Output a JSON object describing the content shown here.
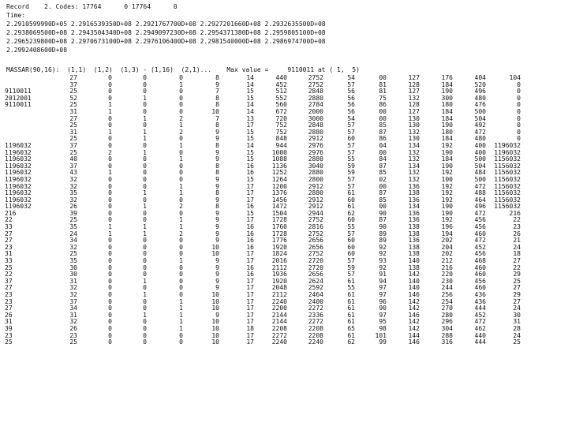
{
  "header": {
    "record_line": "Record    2. Codes: 17764      0 17764      0",
    "times_label": "Time:",
    "times": [
      "2.2910599990D+05 2.2916539350D+08 2.2921767700D+08 2.2927201660D+08 2.2932635500D+08",
      "2.2938069500D+08 2.2943504340D+08 2.2949097230D+08 2.2954371380D+08 2.2959805100D+08",
      "2.2965239800D+08 2.2970673100D+08 2.2976106400D+08 2.2981540000D+08 2.2986974700D+08",
      "2.2992408600D+08"
    ],
    "matrix_line": "MASSAR(90,16):  (1,1)  (1,2)  (1,3) - (1,16)  (2,1)...    Max value =     9110011 at ( 1,  5)"
  },
  "rows": [
    [
      "",
      "27",
      "0",
      "0",
      "0",
      "8",
      "14",
      "440",
      "2752",
      "54",
      "00",
      "127",
      "176",
      "404",
      "104"
    ],
    [
      "",
      "37",
      "0",
      "0",
      "1",
      "9",
      "14",
      "452",
      "2752",
      "57",
      "81",
      "128",
      "184",
      "520",
      "0"
    ],
    [
      "9110011",
      "25",
      "0",
      "0",
      "0",
      "7",
      "15",
      "512",
      "2848",
      "56",
      "81",
      "127",
      "190",
      "496",
      "0"
    ],
    [
      "2012001",
      "52",
      "0",
      "1",
      "0",
      "8",
      "15",
      "552",
      "2880",
      "56",
      "75",
      "132",
      "300",
      "480",
      "0"
    ],
    [
      "9110011",
      "25",
      "1",
      "0",
      "0",
      "8",
      "14",
      "560",
      "2784",
      "56",
      "86",
      "128",
      "180",
      "476",
      "0"
    ],
    [
      "",
      "31",
      "1",
      "0",
      "0",
      "10",
      "14",
      "672",
      "2000",
      "56",
      "00",
      "127",
      "184",
      "500",
      "0"
    ],
    [
      "",
      "27",
      "0",
      "1",
      "2",
      "7",
      "13",
      "720",
      "3000",
      "54",
      "00",
      "130",
      "184",
      "504",
      "0"
    ],
    [
      "",
      "25",
      "0",
      "0",
      "1",
      "8",
      "17",
      "752",
      "2848",
      "57",
      "85",
      "130",
      "190",
      "492",
      "0"
    ],
    [
      "",
      "31",
      "1",
      "1",
      "2",
      "9",
      "15",
      "752",
      "2880",
      "57",
      "87",
      "132",
      "180",
      "472",
      "0"
    ],
    [
      "",
      "25",
      "0",
      "1",
      "0",
      "9",
      "15",
      "848",
      "2912",
      "60",
      "86",
      "130",
      "184",
      "480",
      "0"
    ],
    [
      "1196032",
      "37",
      "0",
      "0",
      "1",
      "8",
      "14",
      "944",
      "2976",
      "57",
      "04",
      "134",
      "192",
      "400",
      "1196032"
    ],
    [
      "1196032",
      "25",
      "2",
      "1",
      "0",
      "9",
      "15",
      "1000",
      "2976",
      "57",
      "00",
      "132",
      "190",
      "400",
      "1196032"
    ],
    [
      "1196032",
      "40",
      "0",
      "0",
      "1",
      "9",
      "15",
      "1088",
      "2880",
      "55",
      "84",
      "132",
      "184",
      "500",
      "1156032"
    ],
    [
      "1196032",
      "37",
      "0",
      "0",
      "0",
      "8",
      "16",
      "1136",
      "3040",
      "59",
      "87",
      "134",
      "190",
      "504",
      "1156032"
    ],
    [
      "1196032",
      "43",
      "1",
      "0",
      "0",
      "8",
      "16",
      "1252",
      "2880",
      "59",
      "85",
      "132",
      "192",
      "484",
      "1156032"
    ],
    [
      "1196032",
      "32",
      "0",
      "0",
      "0",
      "9",
      "15",
      "1264",
      "2800",
      "57",
      "02",
      "132",
      "100",
      "500",
      "1156032"
    ],
    [
      "1196032",
      "32",
      "0",
      "0",
      "1",
      "9",
      "17",
      "1200",
      "2912",
      "57",
      "00",
      "136",
      "192",
      "472",
      "1156032"
    ],
    [
      "1196032",
      "35",
      "0",
      "1",
      "1",
      "8",
      "17",
      "1376",
      "2880",
      "61",
      "87",
      "138",
      "192",
      "488",
      "1156032"
    ],
    [
      "1196032",
      "32",
      "0",
      "0",
      "0",
      "9",
      "17",
      "1456",
      "2912",
      "60",
      "85",
      "136",
      "192",
      "464",
      "1156032"
    ],
    [
      "1196032",
      "26",
      "0",
      "1",
      "2",
      "8",
      "16",
      "1472",
      "2912",
      "61",
      "00",
      "134",
      "190",
      "496",
      "1156032"
    ],
    [
      "216",
      "39",
      "0",
      "0",
      "0",
      "9",
      "15",
      "1504",
      "2944",
      "62",
      "90",
      "136",
      "190",
      "472",
      "216"
    ],
    [
      "22",
      "25",
      "0",
      "0",
      "1",
      "9",
      "17",
      "1728",
      "2752",
      "60",
      "87",
      "136",
      "192",
      "456",
      "22"
    ],
    [
      "33",
      "35",
      "1",
      "1",
      "1",
      "9",
      "16",
      "1760",
      "2816",
      "55",
      "90",
      "138",
      "196",
      "456",
      "23"
    ],
    [
      "27",
      "24",
      "1",
      "1",
      "2",
      "9",
      "16",
      "1728",
      "2752",
      "57",
      "89",
      "138",
      "194",
      "460",
      "26"
    ],
    [
      "27",
      "34",
      "0",
      "0",
      "0",
      "9",
      "16",
      "1776",
      "2656",
      "60",
      "89",
      "136",
      "202",
      "472",
      "21"
    ],
    [
      "23",
      "32",
      "0",
      "0",
      "0",
      "10",
      "16",
      "1920",
      "2656",
      "60",
      "92",
      "138",
      "204",
      "452",
      "24"
    ],
    [
      "31",
      "25",
      "0",
      "0",
      "0",
      "10",
      "17",
      "1824",
      "2752",
      "60",
      "92",
      "138",
      "202",
      "456",
      "18"
    ],
    [
      "33",
      "35",
      "0",
      "0",
      "1",
      "9",
      "17",
      "2016",
      "2720",
      "57",
      "93",
      "140",
      "212",
      "468",
      "27"
    ],
    [
      "25",
      "30",
      "0",
      "0",
      "0",
      "9",
      "16",
      "2112",
      "2720",
      "59",
      "92",
      "138",
      "216",
      "460",
      "22"
    ],
    [
      "22",
      "30",
      "0",
      "0",
      "0",
      "9",
      "16",
      "1936",
      "2656",
      "57",
      "91",
      "142",
      "220",
      "460",
      "29"
    ],
    [
      "37",
      "31",
      "0",
      "1",
      "0",
      "9",
      "17",
      "1920",
      "2624",
      "61",
      "94",
      "140",
      "230",
      "456",
      "25"
    ],
    [
      "27",
      "32",
      "0",
      "0",
      "0",
      "9",
      "17",
      "2048",
      "2592",
      "55",
      "97",
      "140",
      "244",
      "460",
      "27"
    ],
    [
      "23",
      "32",
      "0",
      "1",
      "0",
      "10",
      "17",
      "2112",
      "2464",
      "61",
      "97",
      "146",
      "256",
      "436",
      "29"
    ],
    [
      "23",
      "37",
      "0",
      "0",
      "1",
      "10",
      "17",
      "2240",
      "2400",
      "61",
      "96",
      "142",
      "254",
      "436",
      "27"
    ],
    [
      "27",
      "34",
      "0",
      "0",
      "1",
      "10",
      "17",
      "2200",
      "2272",
      "61",
      "90",
      "142",
      "270",
      "444",
      "24"
    ],
    [
      "26",
      "31",
      "0",
      "1",
      "1",
      "9",
      "17",
      "2144",
      "2336",
      "61",
      "97",
      "146",
      "280",
      "452",
      "30"
    ],
    [
      "31",
      "32",
      "0",
      "0",
      "1",
      "10",
      "17",
      "2144",
      "2272",
      "61",
      "95",
      "142",
      "296",
      "472",
      "31"
    ],
    [
      "39",
      "26",
      "0",
      "0",
      "1",
      "10",
      "18",
      "2208",
      "2208",
      "65",
      "98",
      "142",
      "304",
      "462",
      "28"
    ],
    [
      "23",
      "23",
      "0",
      "0",
      "0",
      "10",
      "17",
      "2272",
      "2208",
      "61",
      "101",
      "144",
      "288",
      "440",
      "24"
    ],
    [
      "25",
      "25",
      "0",
      "0",
      "0",
      "10",
      "17",
      "2240",
      "2240",
      "62",
      "99",
      "146",
      "316",
      "444",
      "25"
    ]
  ]
}
